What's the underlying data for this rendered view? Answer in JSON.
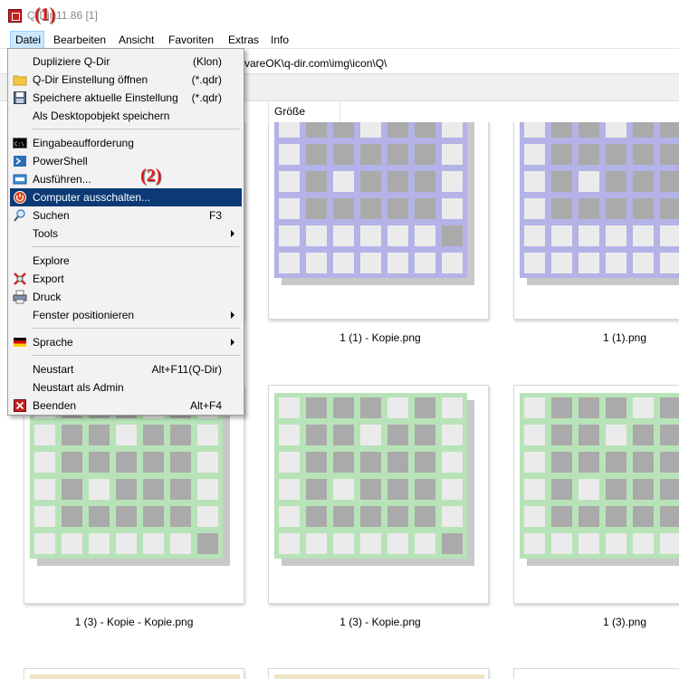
{
  "window": {
    "title": "Q-Dir 11.86 [1]"
  },
  "callouts": {
    "one": "(1)",
    "two": "(2)"
  },
  "menubar": [
    {
      "label": "Datei",
      "name": "menu-datei",
      "active": true
    },
    {
      "label": "Bearbeiten",
      "name": "menu-bearbeiten"
    },
    {
      "label": "Ansicht",
      "name": "menu-ansicht"
    },
    {
      "label": "Favoriten",
      "name": "menu-favoriten"
    },
    {
      "label": "Extras",
      "name": "menu-extras"
    },
    {
      "label": "Info",
      "name": "menu-info"
    }
  ],
  "address": {
    "path_visible": "vareOK\\q-dir.com\\img\\icon\\Q\\"
  },
  "columns": {
    "size": "Größe"
  },
  "datei_menu": [
    {
      "type": "item",
      "label": "Dupliziere Q-Dir",
      "shortcut": "(Klon)",
      "icon": ""
    },
    {
      "type": "item",
      "label": "Q-Dir Einstellung öffnen",
      "shortcut": "(*.qdr)",
      "icon": "folder-icon"
    },
    {
      "type": "item",
      "label": "Speichere  aktuelle Einstellung",
      "shortcut": "(*.qdr)",
      "icon": "save-icon"
    },
    {
      "type": "item",
      "label": "Als Desktopobjekt speichern",
      "shortcut": "",
      "icon": ""
    },
    {
      "type": "sep"
    },
    {
      "type": "item",
      "label": "Eingabeaufforderung",
      "shortcut": "",
      "icon": "command-prompt-icon"
    },
    {
      "type": "item",
      "label": "PowerShell",
      "shortcut": "",
      "icon": "powershell-icon"
    },
    {
      "type": "item",
      "label": "Ausführen...",
      "shortcut": "",
      "icon": "run-icon"
    },
    {
      "type": "item",
      "label": "Computer ausschalten...",
      "shortcut": "",
      "icon": "power-icon",
      "highlight": true
    },
    {
      "type": "item",
      "label": "Suchen",
      "shortcut": "F3",
      "icon": "search-icon"
    },
    {
      "type": "item",
      "label": "Tools",
      "shortcut": "",
      "icon": "",
      "submenu": true
    },
    {
      "type": "sep"
    },
    {
      "type": "item",
      "label": "Explore",
      "shortcut": "",
      "icon": ""
    },
    {
      "type": "item",
      "label": "Export",
      "shortcut": "",
      "icon": "export-icon"
    },
    {
      "type": "item",
      "label": "Druck",
      "shortcut": "",
      "icon": "print-icon"
    },
    {
      "type": "item",
      "label": "Fenster positionieren",
      "shortcut": "",
      "icon": "",
      "submenu": true
    },
    {
      "type": "sep"
    },
    {
      "type": "item",
      "label": "Sprache",
      "shortcut": "",
      "icon": "language-flag-icon",
      "submenu": true
    },
    {
      "type": "sep"
    },
    {
      "type": "item",
      "label": "Neustart",
      "shortcut": "Alt+F11(Q-Dir)",
      "icon": ""
    },
    {
      "type": "item",
      "label": "Neustart als Admin",
      "shortcut": "",
      "icon": ""
    },
    {
      "type": "item",
      "label": "Beenden",
      "shortcut": "Alt+F4",
      "icon": "exit-icon"
    }
  ],
  "files": [
    {
      "label": "1 (1) - Kopie.png",
      "color": "#b3b3e8"
    },
    {
      "label": "1 (1).png",
      "color": "#b3b3e8"
    },
    {
      "label": "1 (3) - Kopie - Kopie.png",
      "color": "#b8e3b8"
    },
    {
      "label": "1 (3) - Kopie.png",
      "color": "#b8e3b8"
    },
    {
      "label": "1 (3).png",
      "color": "#b8e3b8"
    }
  ],
  "colors": {
    "menu_highlight": "#0b3a75",
    "grid_light": "#ebebeb",
    "grid_dark": "#aaaaaa",
    "bottom_row_tint": "#ede4c3"
  }
}
